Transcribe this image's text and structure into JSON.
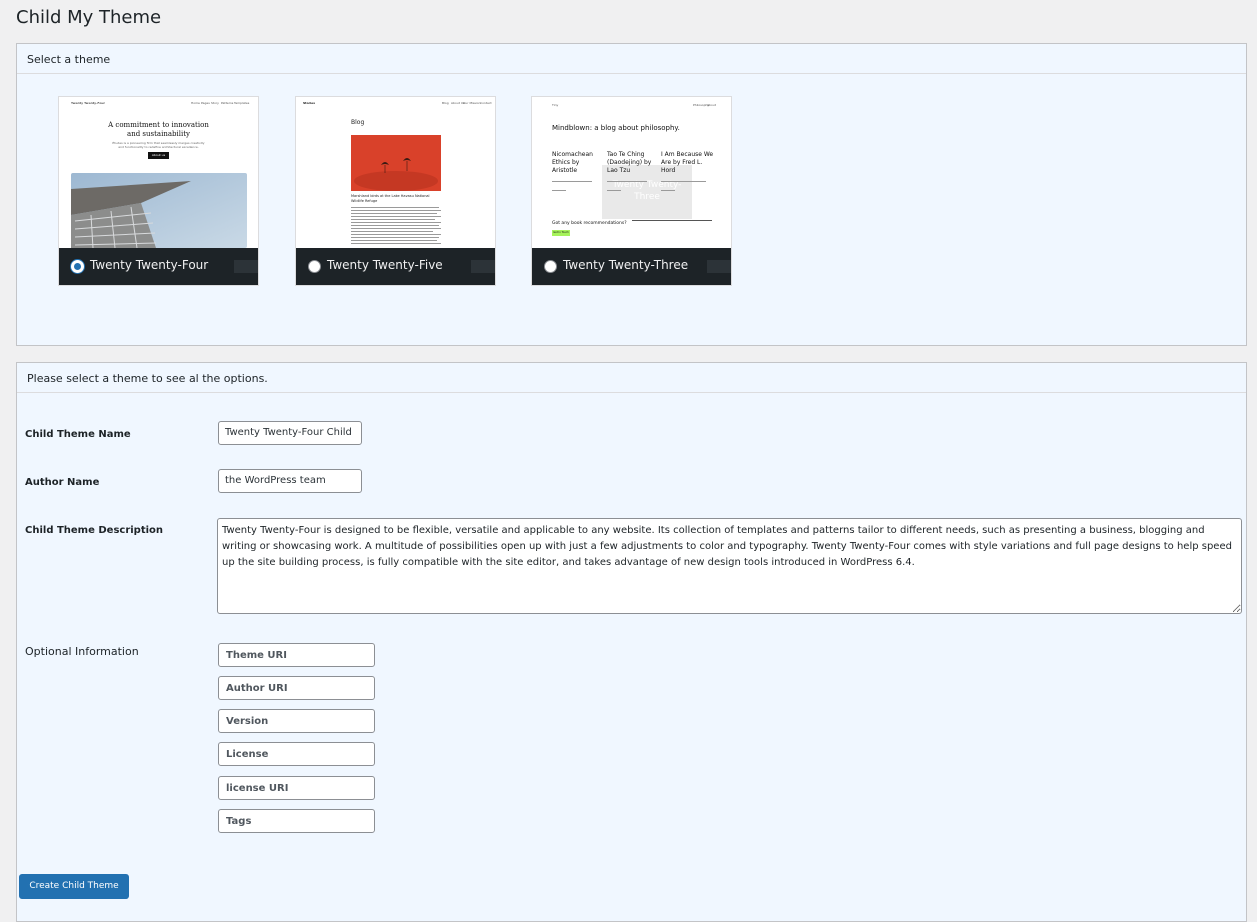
{
  "page": {
    "title": "Child My Theme"
  },
  "theme_panel": {
    "header": "Select a theme",
    "themes": [
      {
        "name": "Twenty Twenty-Four",
        "checked": true,
        "preview": {
          "site": "Twenty Twenty-Four",
          "nav": [
            "Home",
            "Pages",
            "Story",
            "Patterns",
            "Templates"
          ],
          "heading_line1": "A commitment to innovation",
          "heading_line2": "and sustainability",
          "sub_line1": "Études is a pioneering firm that seamlessly merges creativity",
          "sub_line2": "and functionality to redefine architectural excellence.",
          "button": "About us"
        }
      },
      {
        "name": "Twenty Twenty-Five",
        "checked": false,
        "preview": {
          "site": "Stories",
          "nav": [
            "Blog",
            "About Us",
            "Our Mission",
            "Contact"
          ],
          "heading": "Blog",
          "caption_line1": "Marshland birds at the Lake Havasu National",
          "caption_line2": "Wildlife Refuge"
        }
      },
      {
        "name": "Twenty Twenty-Three",
        "checked": false,
        "preview": {
          "site": "Tiny",
          "nav": [
            "Philosophy",
            "About"
          ],
          "heading": "Mindblown: a blog about philosophy.",
          "posts": [
            {
              "title_lines": [
                "Nicomachean",
                "Ethics by",
                "Aristotle"
              ]
            },
            {
              "title_lines": [
                "Tao Te Ching",
                "(Daodejing) by",
                "Lao Tzu"
              ]
            },
            {
              "title_lines": [
                "I Am Because We",
                "Are by Fred L.",
                "Hord"
              ]
            }
          ],
          "overlay_line1": "Twenty Twenty-",
          "overlay_line2": "Three",
          "footer_text": "Got any book recommendations?",
          "footer_button": "Get In Touch"
        }
      }
    ]
  },
  "options_panel": {
    "header": "Please select a theme to see al the options.",
    "child_theme_name": {
      "label": "Child Theme Name",
      "value": "Twenty Twenty-Four Child"
    },
    "author_name": {
      "label": "Author Name",
      "value": "the WordPress team"
    },
    "description": {
      "label": "Child Theme Description",
      "value": "Twenty Twenty-Four is designed to be flexible, versatile and applicable to any website. Its collection of templates and patterns tailor to different needs, such as presenting a business, blogging and writing or showcasing work. A multitude of possibilities open up with just a few adjustments to color and typography. Twenty Twenty-Four comes with style variations and full page designs to help speed up the site building process, is fully compatible with the site editor, and takes advantage of new design tools introduced in WordPress 6.4."
    },
    "optional": {
      "label": "Optional Information",
      "fields": [
        {
          "placeholder": "Theme URI"
        },
        {
          "placeholder": "Author URI"
        },
        {
          "placeholder": "Version"
        },
        {
          "placeholder": "License"
        },
        {
          "placeholder": "license URI"
        },
        {
          "placeholder": "Tags"
        }
      ]
    },
    "submit_label": "Create Child Theme"
  },
  "colors": {
    "page_bg": "#f0f0f1",
    "panel_bg": "#f0f7ff",
    "button_blue": "#2271b1",
    "theme_bar": "#1d2327",
    "preview_red": "#d9412a"
  }
}
